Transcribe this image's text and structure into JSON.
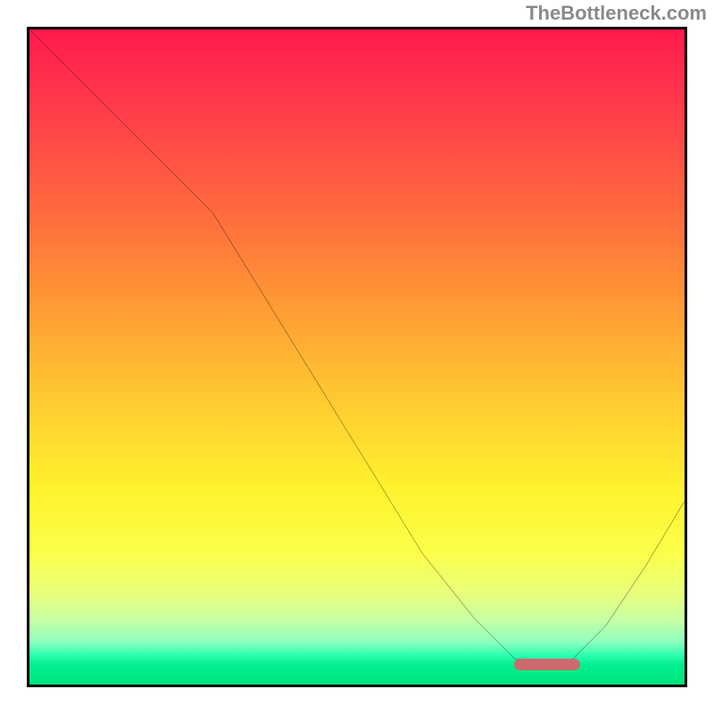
{
  "watermark": "TheBottleneck.com",
  "chart_data": {
    "type": "line",
    "title": "",
    "xlabel": "",
    "ylabel": "",
    "xlim": [
      0,
      100
    ],
    "ylim": [
      0,
      100
    ],
    "grid": false,
    "legend": false,
    "background_gradient": {
      "direction": "vertical",
      "stops": [
        {
          "pos": 0,
          "color": "#ff1a4d"
        },
        {
          "pos": 12,
          "color": "#ff3b4a"
        },
        {
          "pos": 28,
          "color": "#ff6a3d"
        },
        {
          "pos": 42,
          "color": "#ff9a35"
        },
        {
          "pos": 56,
          "color": "#ffc831"
        },
        {
          "pos": 70,
          "color": "#fff22e"
        },
        {
          "pos": 80,
          "color": "#fbff4a"
        },
        {
          "pos": 86,
          "color": "#e8ff7a"
        },
        {
          "pos": 90,
          "color": "#c9ffa3"
        },
        {
          "pos": 93.5,
          "color": "#8effc0"
        },
        {
          "pos": 95.5,
          "color": "#2fffb0"
        },
        {
          "pos": 97,
          "color": "#00f090"
        },
        {
          "pos": 100,
          "color": "#00e37a"
        }
      ]
    },
    "series": [
      {
        "name": "bottleneck-curve",
        "color": "#000000",
        "x": [
          0,
          8,
          16,
          24,
          28,
          36,
          44,
          52,
          60,
          68,
          74,
          78,
          82,
          88,
          94,
          100
        ],
        "y": [
          100,
          92,
          84,
          76,
          72,
          59,
          46,
          33,
          20,
          10,
          4,
          3,
          3,
          9,
          18,
          28
        ]
      }
    ],
    "marker": {
      "name": "optimal-range",
      "color": "#cc6a6d",
      "x_start": 74,
      "x_end": 84,
      "y": 3.2
    }
  },
  "colors": {
    "frame_border": "#000000",
    "curve": "#000000",
    "marker": "#cc6a6d",
    "watermark": "#8a8a8a"
  }
}
